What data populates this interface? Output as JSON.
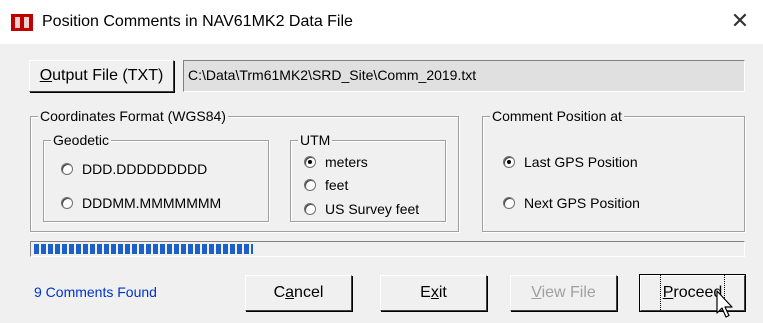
{
  "window": {
    "title": "Position Comments in NAV61MK2 Data File",
    "close_glyph": "✕"
  },
  "output": {
    "button_label_prefix": "O",
    "button_label_rest": "utput File (TXT)",
    "path": "C:\\Data\\Trm61MK2\\SRD_Site\\Comm_2019.txt"
  },
  "coords": {
    "group_label": "Coordinates Format (WGS84)",
    "geodetic": {
      "label": "Geodetic",
      "options": [
        {
          "label": "DDD.DDDDDDDDD",
          "checked": false
        },
        {
          "label": "DDDMM.MMMMMMM",
          "checked": false
        }
      ]
    },
    "utm": {
      "label": "UTM",
      "options": [
        {
          "label": "meters",
          "checked": true
        },
        {
          "label": "feet",
          "checked": false
        },
        {
          "label": "US Survey feet",
          "checked": false
        }
      ]
    }
  },
  "comment_position": {
    "group_label": "Comment Position at",
    "options": [
      {
        "label": "Last GPS Position",
        "checked": true
      },
      {
        "label": "Next GPS Position",
        "checked": false
      }
    ]
  },
  "progress": {
    "fraction": 0.31,
    "color": "#1c5fc9"
  },
  "status_text": "9 Comments Found",
  "buttons": {
    "cancel": {
      "pre": "C",
      "ul": "a",
      "post": "ncel"
    },
    "exit": {
      "pre": "E",
      "ul": "x",
      "post": "it"
    },
    "view": {
      "pre": "",
      "ul": "V",
      "post": "iew File"
    },
    "proceed": {
      "pre": "",
      "ul": "P",
      "post": "roceed"
    }
  }
}
